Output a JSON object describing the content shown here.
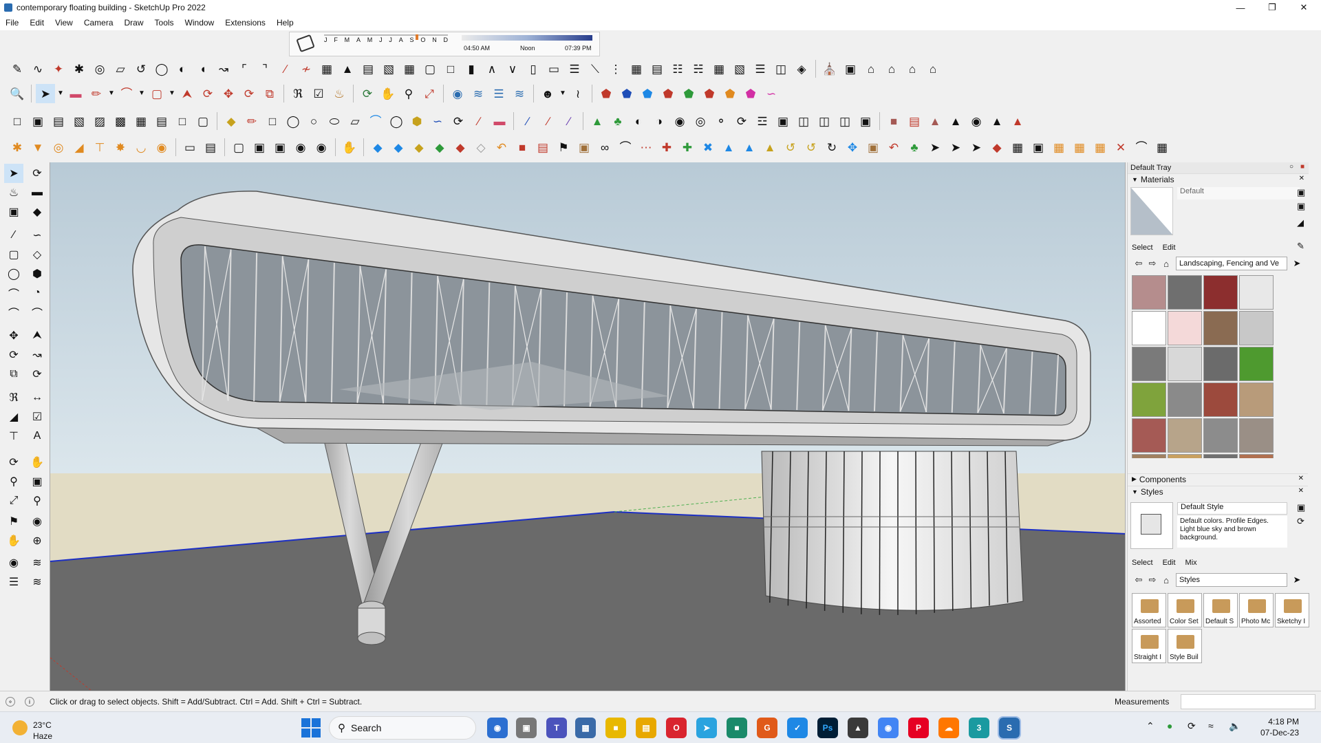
{
  "window": {
    "title": "contemporary floating building - SketchUp Pro 2022",
    "minimize_icon": "minimize-icon",
    "maximize_icon": "restore-icon",
    "close_icon": "close-icon"
  },
  "menu": [
    "File",
    "Edit",
    "View",
    "Camera",
    "Draw",
    "Tools",
    "Window",
    "Extensions",
    "Help"
  ],
  "shadow": {
    "months": [
      "J",
      "F",
      "M",
      "A",
      "M",
      "J",
      "J",
      "A",
      "S",
      "O",
      "N",
      "D"
    ],
    "time_start": "04:50 AM",
    "time_mid": "Noon",
    "time_end": "07:39 PM"
  },
  "tray": {
    "title": "Default Tray",
    "materials": {
      "section": "Materials",
      "current": "Default",
      "tab_select": "Select",
      "tab_edit": "Edit",
      "collection": "Landscaping, Fencing and Ve",
      "swatch_colors": [
        "#b58d8d",
        "#6f6f6f",
        "#8c2e2e",
        "#e8e8e8",
        "#ffffff",
        "#f4d9d9",
        "#8a6b52",
        "#c8c8c8",
        "#7a7a7a",
        "#d8d8d8",
        "#6b6b6b",
        "#4e9a2f",
        "#7fa33c",
        "#8a8a8a",
        "#9c4a3d",
        "#b89b7a",
        "#a55a55",
        "#b7a48a",
        "#8c8c8c",
        "#9a8f86",
        "#a08060",
        "#c8a060",
        "#707070",
        "#b07050"
      ]
    },
    "components": {
      "section": "Components"
    },
    "styles": {
      "section": "Styles",
      "current": "Default Style",
      "description": "Default colors. Profile Edges. Light blue sky and brown background.",
      "tab_select": "Select",
      "tab_edit": "Edit",
      "tab_mix": "Mix",
      "collection": "Styles",
      "items": [
        "Assorted",
        "Color Set",
        "Default S",
        "Photo Mc",
        "Sketchy I",
        "Straight I",
        "Style Buil"
      ]
    }
  },
  "status": {
    "hint": "Click or drag to select objects. Shift = Add/Subtract. Ctrl = Add. Shift + Ctrl = Subtract.",
    "measurements_label": "Measurements",
    "measurements_value": ""
  },
  "taskbar": {
    "temp": "23°C",
    "condition": "Haze",
    "search": "Search",
    "time": "4:18 PM",
    "date": "07-Dec-23"
  },
  "colors": {
    "sky": "#cfdde6",
    "ground": "#e2dcc4",
    "plane": "#6a6a6a",
    "building": "#dedede",
    "accent_red": "#c0392b"
  }
}
